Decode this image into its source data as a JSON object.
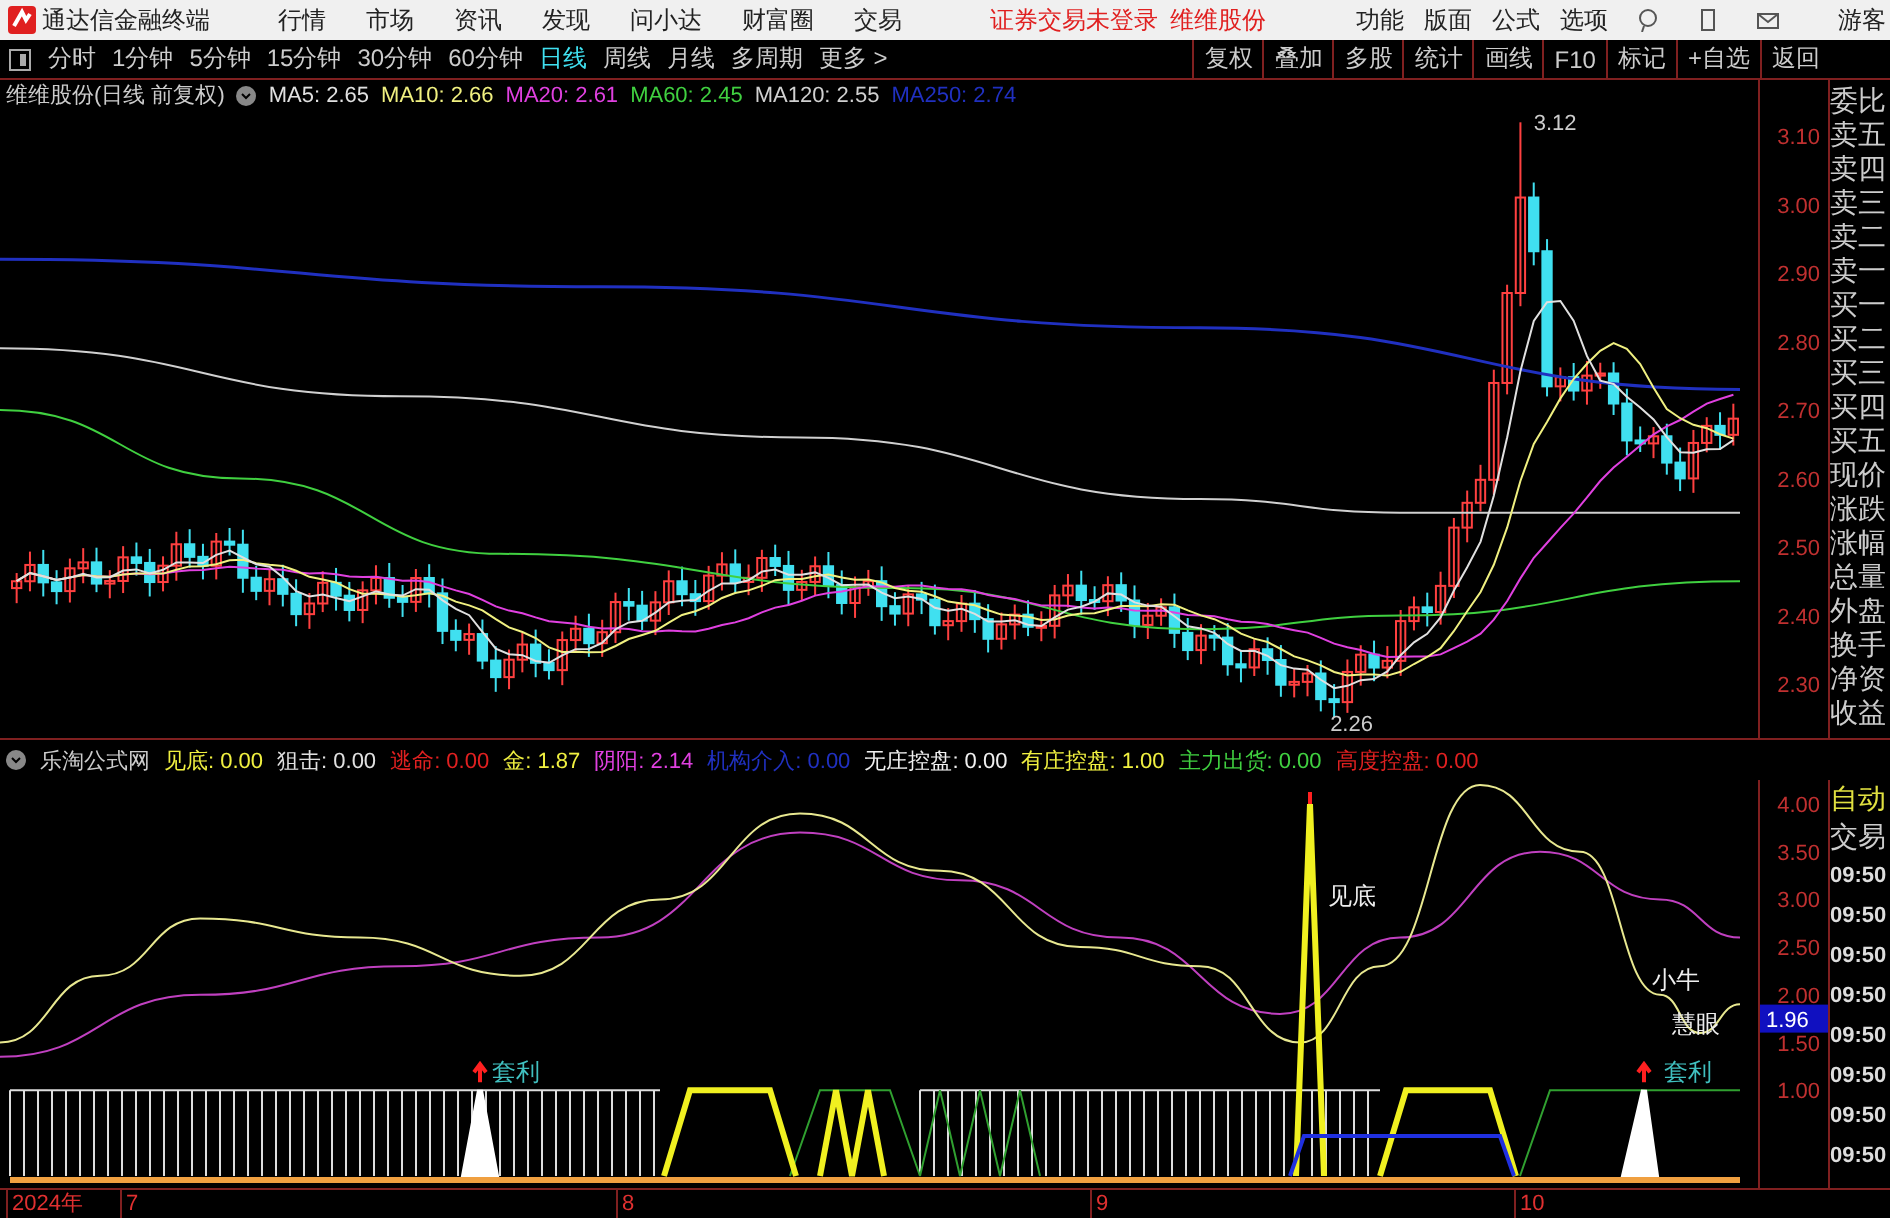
{
  "app": {
    "title": "通达信金融终端",
    "menus": [
      "行情",
      "市场",
      "资讯",
      "发现",
      "问小达",
      "财富圈",
      "交易"
    ],
    "status": "证券交易未登录",
    "stock": "维维股份",
    "right_menus": [
      "功能",
      "版面",
      "公式",
      "选项"
    ],
    "user": "游客"
  },
  "periods": [
    {
      "label": "分时",
      "selected": false
    },
    {
      "label": "1分钟",
      "selected": false
    },
    {
      "label": "5分钟",
      "selected": false
    },
    {
      "label": "15分钟",
      "selected": false
    },
    {
      "label": "30分钟",
      "selected": false
    },
    {
      "label": "60分钟",
      "selected": false
    },
    {
      "label": "日线",
      "selected": true
    },
    {
      "label": "周线",
      "selected": false
    },
    {
      "label": "月线",
      "selected": false
    },
    {
      "label": "多周期",
      "selected": false
    },
    {
      "label": "更多 >",
      "selected": false
    }
  ],
  "tools": [
    "复权",
    "叠加",
    "多股",
    "统计",
    "画线",
    "F10",
    "标记",
    "+自选",
    "返回"
  ],
  "main_chart": {
    "title": "维维股份(日线 前复权)",
    "legend": [
      {
        "text": "MA5: 2.65",
        "color": "#e0e0e0"
      },
      {
        "text": "MA10: 2.66",
        "color": "#f0f080"
      },
      {
        "text": "MA20: 2.61",
        "color": "#e040e0"
      },
      {
        "text": "MA60: 2.45",
        "color": "#40d040"
      },
      {
        "text": "MA120: 2.55",
        "color": "#d0d0d0"
      },
      {
        "text": "MA250: 2.74",
        "color": "#2030c0"
      }
    ],
    "yticks": [
      "3.10",
      "3.00",
      "2.90",
      "2.80",
      "2.70",
      "2.60",
      "2.50",
      "2.40",
      "2.30"
    ],
    "high_label": "3.12",
    "low_label": "2.26"
  },
  "quote_labels": [
    "委比",
    "卖五",
    "卖四",
    "卖三",
    "卖二",
    "卖一",
    "买一",
    "买二",
    "买三",
    "买四",
    "买五",
    "现价",
    "涨跌",
    "涨幅",
    "总量",
    "外盘",
    "换手",
    "净资",
    "收益"
  ],
  "indicator": {
    "title": "乐淘公式网",
    "legend": [
      {
        "text": "见底: 0.00",
        "color": "#f0f040"
      },
      {
        "text": "狙击: 0.00",
        "color": "#e0e0e0"
      },
      {
        "text": "逃命: 0.00",
        "color": "#e02020"
      },
      {
        "text": "金: 1.87",
        "color": "#f0f040"
      },
      {
        "text": "阴阳: 2.14",
        "color": "#e040e0"
      },
      {
        "text": "机构介入: 0.00",
        "color": "#2030c0"
      },
      {
        "text": "无庄控盘: 0.00",
        "color": "#f0f0f0"
      },
      {
        "text": "有庄控盘: 1.00",
        "color": "#f0f040"
      },
      {
        "text": "主力出货: 0.00",
        "color": "#40d040"
      },
      {
        "text": "高度控盘: 0.00",
        "color": "#e02020"
      }
    ],
    "yticks": [
      "4.00",
      "3.50",
      "3.00",
      "2.50",
      "2.00",
      "1.50",
      "1.00"
    ],
    "cursor_value": "1.96",
    "labels": [
      "套利",
      "见底",
      "小牛",
      "慧眼",
      "套利"
    ]
  },
  "trade_panel": {
    "header": [
      "自动",
      "交易"
    ],
    "times": [
      "09:50",
      "09:50",
      "09:50",
      "09:50",
      "09:50",
      "09:50",
      "09:50",
      "09:50"
    ]
  },
  "date_axis": [
    "2024年",
    "7",
    "8",
    "9",
    "10"
  ]
}
